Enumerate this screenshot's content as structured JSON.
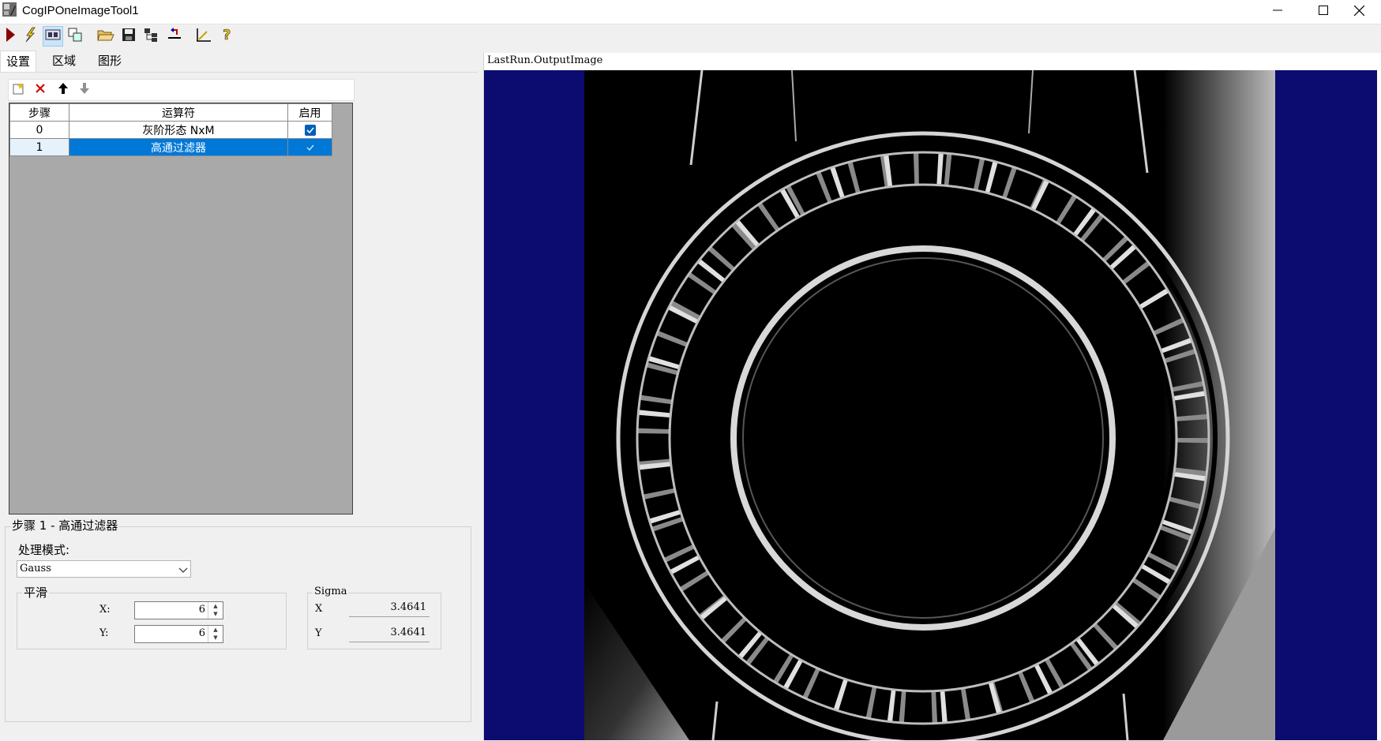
{
  "window": {
    "title": "CogIPOneImageTool1",
    "minimize_icon": "minimize-icon",
    "maximize_icon": "maximize-icon",
    "close_icon": "close-icon"
  },
  "toolbar": {
    "buttons": [
      {
        "name": "run-icon"
      },
      {
        "name": "electric-icon"
      },
      {
        "name": "show-image-icon",
        "pressed": true
      },
      {
        "name": "copy-window-icon"
      },
      {
        "name": "open-folder-icon"
      },
      {
        "name": "save-icon"
      },
      {
        "name": "tree-icon"
      },
      {
        "name": "reset-icon"
      },
      {
        "name": "measure-icon"
      },
      {
        "name": "help-icon"
      }
    ]
  },
  "tabs": [
    {
      "label": "设置",
      "active": true
    },
    {
      "label": "区域",
      "active": false
    },
    {
      "label": "图形",
      "active": false
    }
  ],
  "operator_grid": {
    "toolbar_icons": [
      "new-icon",
      "delete-icon",
      "move-up-icon",
      "move-down-icon"
    ],
    "headers": {
      "step": "步骤",
      "operator": "运算符",
      "enabled": "启用"
    },
    "rows": [
      {
        "step": "0",
        "operator": "灰阶形态 NxM",
        "enabled": true,
        "selected": false
      },
      {
        "step": "1",
        "operator": "高通过滤器",
        "enabled": true,
        "selected": true
      }
    ]
  },
  "step_panel": {
    "title": "步骤 1 - 高通过滤器",
    "mode_label": "处理模式:",
    "mode_value": "Gauss",
    "smooth": {
      "legend": "平滑",
      "x_label": "X:",
      "x_value": "6",
      "y_label": "Y:",
      "y_value": "6"
    },
    "sigma": {
      "legend": "Sigma",
      "x_label": "X",
      "x_value": "3.4641",
      "y_label": "Y",
      "y_value": "3.4641"
    }
  },
  "display": {
    "label": "LastRun.OutputImage",
    "background_color": "#0b0b70"
  }
}
